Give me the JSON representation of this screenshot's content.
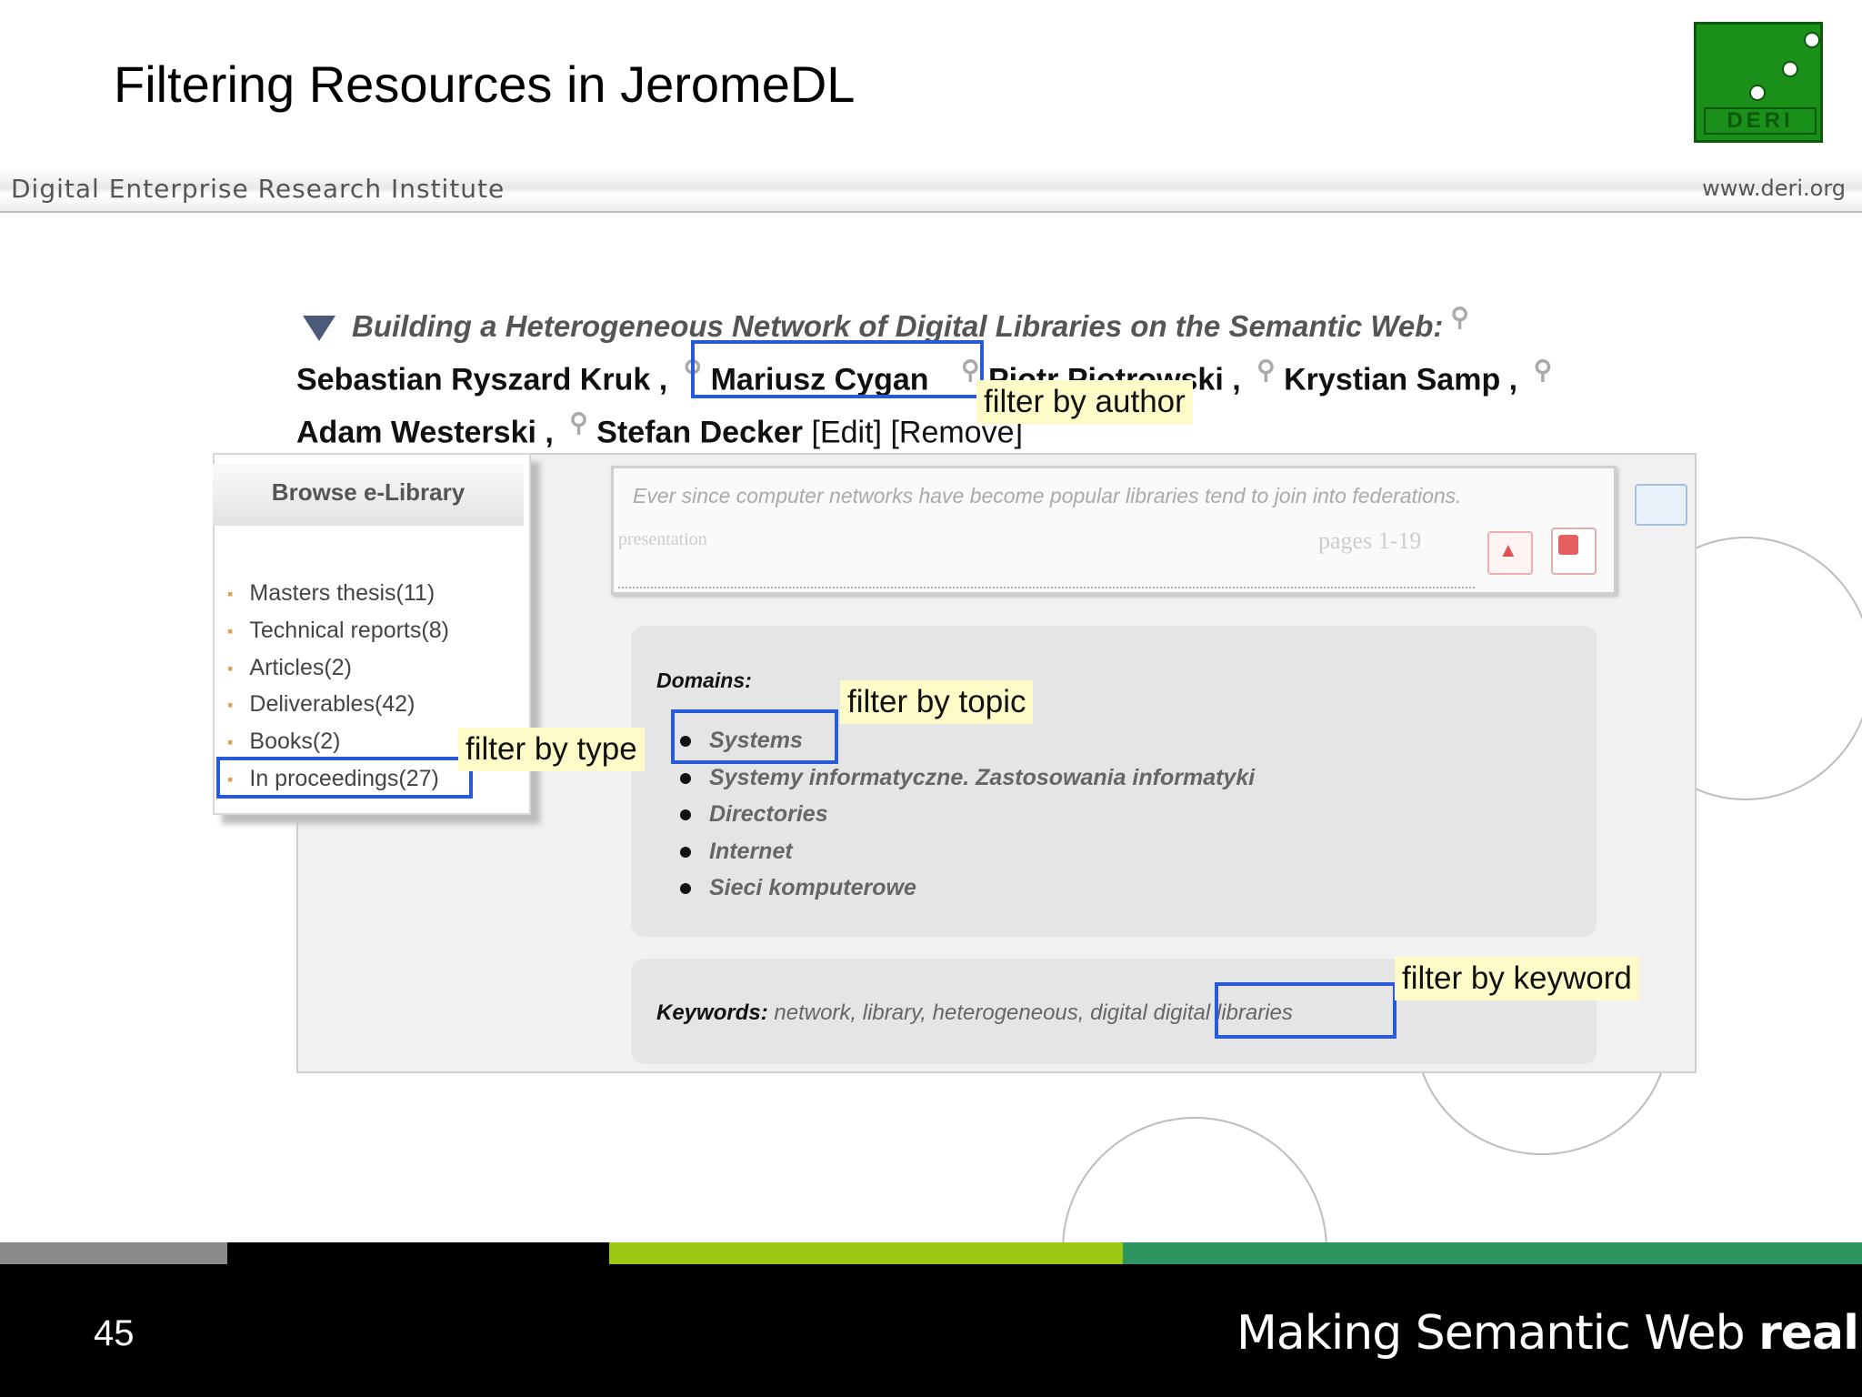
{
  "slide": {
    "title": "Filtering Resources in JeromeDL",
    "institute": "Digital Enterprise Research Institute",
    "url": "www.deri.org",
    "logo_text": "DERI",
    "page_number": "45",
    "tagline_regular": "Making Semantic Web ",
    "tagline_bold": "real."
  },
  "document": {
    "title": "Building a Heterogeneous Network of Digital Libraries on the Semantic Web:",
    "authors": [
      "Sebastian Ryszard Kruk",
      "Mariusz Cygan",
      "Piotr Piotrowski",
      "Krystian Samp",
      "Adam Westerski",
      "Stefan Decker"
    ],
    "separator": ",",
    "edit_label": "[Edit]",
    "remove_label": "[Remove]",
    "abstract": "Ever since computer networks have become popular libraries tend to join into federations.",
    "presentation_label": "presentation",
    "pages_label": "pages 1-19"
  },
  "browse": {
    "title": "Browse e-Library",
    "items": [
      "Masters thesis(11)",
      "Technical reports(8)",
      "Articles(2)",
      "Deliverables(42)",
      "Books(2)",
      "In proceedings(27)"
    ]
  },
  "domains": {
    "label": "Domains:",
    "items": [
      "Systems",
      "Systemy informatyczne. Zastosowania informatyki",
      "Directories",
      "Internet",
      "Sieci komputerowe"
    ]
  },
  "keywords": {
    "label": "Keywords:",
    "values": "network, library, heterogeneous, digital",
    "highlighted": "digital libraries"
  },
  "callouts": {
    "author": "filter by author",
    "type": "filter by type",
    "topic": "filter by topic",
    "keyword": "filter by keyword"
  },
  "colors": {
    "highlight_border": "#2a5bd7",
    "callout_bg": "#fdfcc8",
    "deri_green": "#1a8f1a",
    "stripe_lime": "#9cc813",
    "stripe_green": "#2e9560"
  }
}
